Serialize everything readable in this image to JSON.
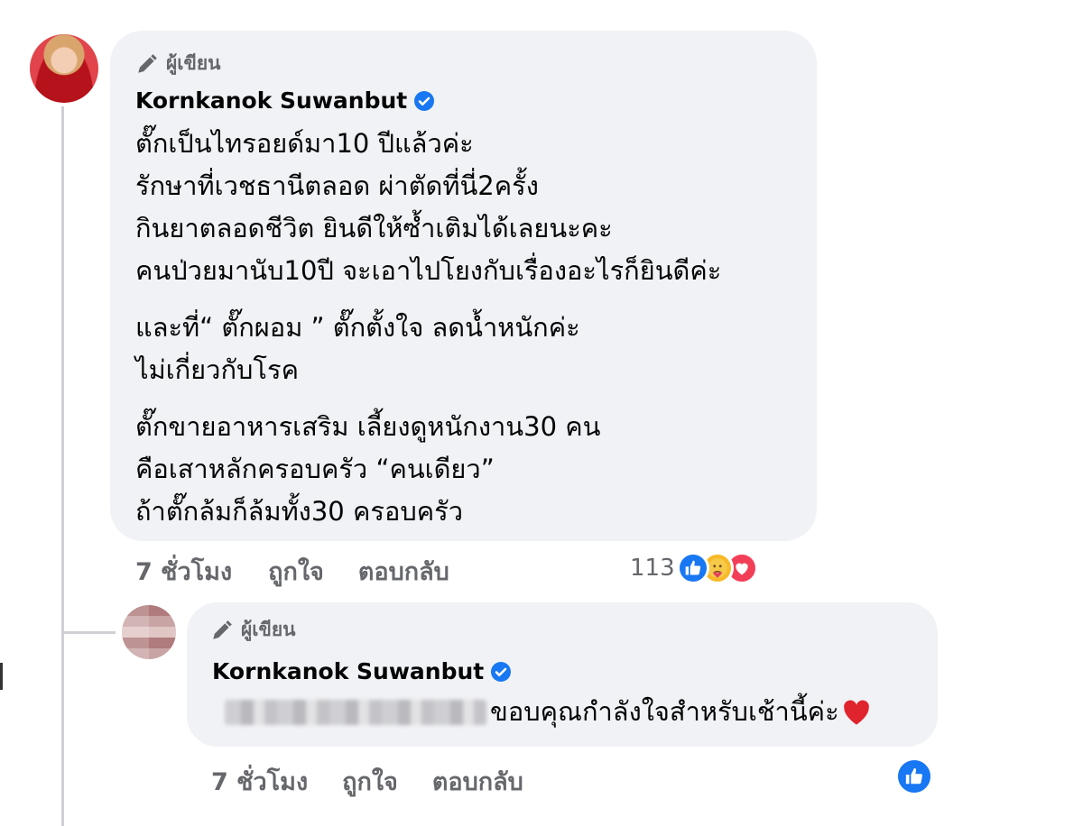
{
  "main_comment": {
    "author_badge": "ผู้เขียน",
    "author_name": "Kornkanok Suwanbut",
    "lines": [
      "ตั๊กเป็นไทรอยด์มา10 ปีแล้วค่ะ",
      "รักษาที่เวชธานีตลอด ผ่าตัดที่นี่2ครั้ง",
      "กินยาตลอดชีวิต ยินดีให้ซ้ำเติมได้เลยนะคะ",
      "คนป่วยมานับ10ปี จะเอาไปโยงกับเรื่องอะไรก็ยินดีค่ะ",
      "และที่“ ตั๊กผอม ” ตั๊กตั้งใจ ลดน้ำหนักค่ะ",
      "ไม่เกี่ยวกับโรค",
      "ตั๊กขายอาหารเสริม เลี้ยงดูหนักงาน30 คน",
      "คือเสาหลักครอบครัว “คนเดียว”",
      "ถ้าตั๊กล้มก็ล้มทั้ง30 ครอบครัว"
    ],
    "time": "7 ชั่วโมง",
    "like_label": "ถูกใจ",
    "reply_label": "ตอบกลับ",
    "reaction_count": "113",
    "reactions": [
      "like-icon",
      "care-icon",
      "love-icon"
    ]
  },
  "reply_comment": {
    "author_badge": "ผู้เขียน",
    "author_name": "Kornkanok Suwanbut",
    "text": "ขอบคุณกำลังใจสำหรับเช้านี้ค่ะ",
    "emoji": "❤️",
    "time": "7 ชั่วโมง",
    "like_label": "ถูกใจ",
    "reply_label": "ตอบกลับ",
    "reactions": [
      "like-icon"
    ]
  },
  "colors": {
    "bubble": "#f0f2f5",
    "secondary_text": "#65676b",
    "verified_blue": "#1877f2"
  }
}
